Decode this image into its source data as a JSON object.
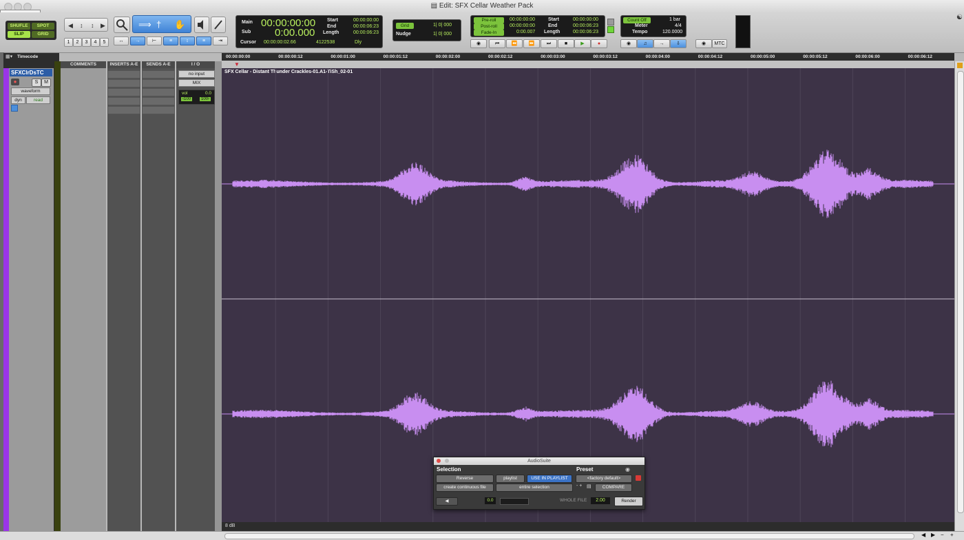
{
  "window": {
    "title": "Edit: SFX Cellar Weather Pack"
  },
  "comments_tab": "Comments °°",
  "modes": {
    "shuffle": "SHUFLE",
    "spot": "SPOT",
    "slip": "SLIP",
    "grid": "GRID"
  },
  "zoom_presets": [
    "1",
    "2",
    "3",
    "4",
    "5"
  ],
  "counters": {
    "main_label": "Main",
    "main_value": "00:00:00:00",
    "sub_label": "Sub",
    "sub_value": "0:00.000",
    "cursor_label": "Cursor",
    "cursor_value": "00:00:00:02.66",
    "sample_value": "4122538",
    "dly_label": "Dly",
    "start_label": "Start",
    "start_value": "00:00:00:00",
    "end_label": "End",
    "end_value": "00:00:06:23",
    "length_label": "Length",
    "length_value": "00:00:06:23"
  },
  "grid_nudge": {
    "grid_label": "Grid",
    "grid_value": "1| 0| 000",
    "nudge_label": "Nudge",
    "nudge_value": "1| 0| 000"
  },
  "preroll": {
    "pre_label": "Pre-roll",
    "pre_value": "00:00:00:00",
    "post_label": "Post-roll",
    "post_value": "00:00:00:00",
    "fade_label": "Fade-In",
    "fade_value": "0:00.007",
    "start_label": "Start",
    "start_value": "00:00:00:00",
    "end_label": "End",
    "end_value": "00:00:06:23",
    "length_label": "Length",
    "length_value": "00:00:06:23"
  },
  "tempo": {
    "count_label": "Count Off",
    "count_value": "1 bar",
    "meter_label": "Meter",
    "meter_value": "4/4",
    "tempo_label": "Tempo",
    "tempo_value": "120.0000"
  },
  "mtc_label": "MTC",
  "ruler": {
    "label": "Timecode",
    "ticks": [
      "00:00:00:00",
      "00:00:00:12",
      "00:00:01:00",
      "00:00:01:12",
      "00:00:02:00",
      "00:00:02:12",
      "00:00:03:00",
      "00:00:03:12",
      "00:00:04:00",
      "00:00:04:12",
      "00:00:05:00",
      "00:00:05:12",
      "00:00:06:00",
      "00:00:06:12"
    ]
  },
  "mix_columns": {
    "comments": "COMMENTS",
    "inserts": "INSERTS A-E",
    "sends": "SENDS A-E",
    "io": "I / O"
  },
  "track": {
    "name": "SFXClrDsTC",
    "solo": "S",
    "mute": "M",
    "view": "waveform",
    "dyn": "dyn",
    "auto_mode": "read",
    "input": "no input",
    "output": "MIX",
    "vol_label": "vol",
    "vol_value": "0.0",
    "pan_left": "‹100",
    "pan_right": "100›"
  },
  "clip": {
    "name": "SFX Cellar - Distant Thunder Crackles-01.A1-TiSh_02-01"
  },
  "zoom_level": "8 dB",
  "audiosuite": {
    "title": "AudioSuite",
    "selection_label": "Selection",
    "preset_label": "Preset",
    "plugin": "Reverse",
    "playlist": "playlist",
    "use_in_playlist": "USE IN PLAYLIST",
    "preset_value": "<factory default>",
    "file_mode": "create continuous file",
    "selection_mode": "entire selection",
    "preset_tools": "- +",
    "compare": "COMPARE",
    "input_value": "0.0",
    "whole_file": "WHOLE FILE",
    "handle_value": "2.00",
    "render": "Render"
  },
  "colors": {
    "waveform": "#c88ef0",
    "edit_background": "#3d3347",
    "track_color": "#9a35e8"
  }
}
